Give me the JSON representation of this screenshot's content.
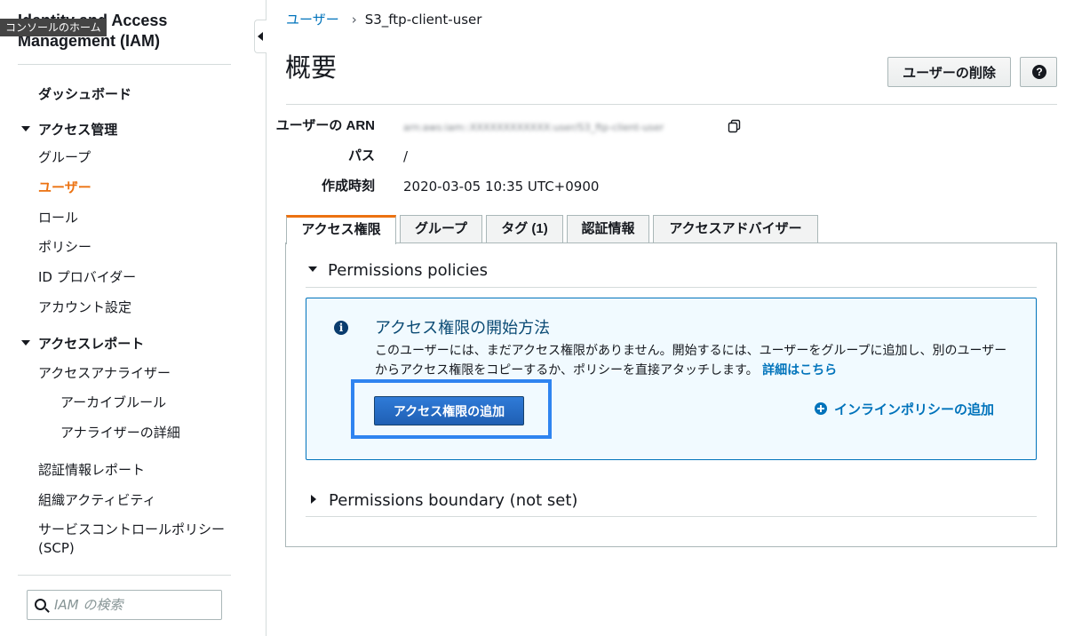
{
  "sidebar": {
    "console_home": "コンソールのホーム",
    "title": "Identity and Access Management (IAM)",
    "dashboard": "ダッシュボード",
    "access_management": {
      "label": "アクセス管理",
      "items": [
        "グループ",
        "ユーザー",
        "ロール",
        "ポリシー",
        "ID プロバイダー",
        "アカウント設定"
      ],
      "active": "ユーザー"
    },
    "access_reports": {
      "label": "アクセスレポート",
      "analyzer": "アクセスアナライザー",
      "sub_items": [
        "アーカイブルール",
        "アナライザーの詳細"
      ],
      "items": [
        "認証情報レポート",
        "組織アクティビティ",
        "サービスコントロールポリシー (SCP)"
      ]
    },
    "search_placeholder": "IAM の検索"
  },
  "breadcrumb": {
    "parent": "ユーザー",
    "current": "S3_ftp-client-user"
  },
  "page": {
    "title": "概要",
    "delete_button": "ユーザーの削除",
    "help_glyph": "?"
  },
  "summary": {
    "arn_label": "ユーザーの ARN",
    "arn_value": "arn:aws:iam::XXXXXXXXXXXX:user/S3_ftp-client-user",
    "path_label": "パス",
    "path_value": "/",
    "created_label": "作成時刻",
    "created_value": "2020-03-05 10:35 UTC+0900"
  },
  "tabs": [
    "アクセス権限",
    "グループ",
    "タグ (1)",
    "認証情報",
    "アクセスアドバイザー"
  ],
  "permissions": {
    "policies_heading": "Permissions policies",
    "info_title": "アクセス権限の開始方法",
    "info_text": "このユーザーには、まだアクセス権限がありません。開始するには、ユーザーをグループに追加し、別のユーザーからアクセス権限をコピーするか、ポリシーを直接アタッチします。",
    "info_link": "詳細はこちら",
    "add_button": "アクセス権限の追加",
    "inline_policy_link": "インラインポリシーの追加",
    "boundary_heading": "Permissions boundary (not set)"
  },
  "colors": {
    "accent_orange": "#ec7211",
    "link_blue": "#0073bb",
    "highlight_blue": "#2f84f0"
  }
}
